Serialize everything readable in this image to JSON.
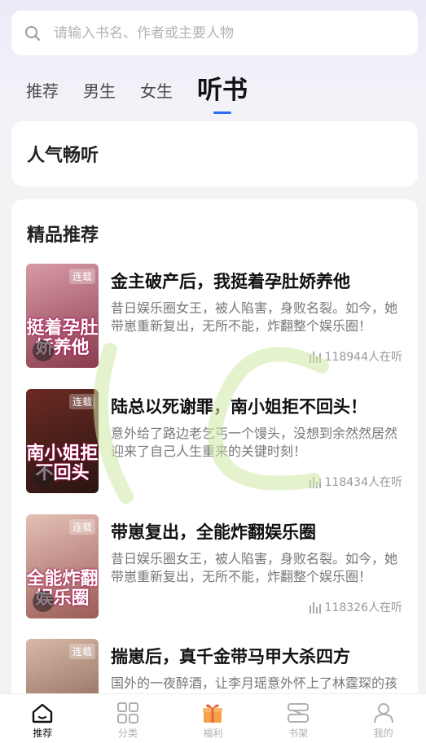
{
  "search": {
    "placeholder": "请输入书名、作者或主要人物"
  },
  "tabs": [
    {
      "label": "推荐",
      "active": false
    },
    {
      "label": "男生",
      "active": false
    },
    {
      "label": "女生",
      "active": false
    },
    {
      "label": "听书",
      "active": true
    }
  ],
  "sections": {
    "popular_title": "人气畅听",
    "featured_title": "精品推荐"
  },
  "books": [
    {
      "title": "金主破产后，我挺着孕肚娇养他",
      "desc": "昔日娱乐圈女王，被人陷害，身败名裂。如今，她带崽重新复出，无所不能，炸翻整个娱乐圈！",
      "listeners": "118944人在听",
      "badge": "连载",
      "cover_text": "挺着孕肚娇养他",
      "cover_colors": [
        "#d79aa6",
        "#8a3b4d"
      ]
    },
    {
      "title": "陆总以死谢罪，南小姐拒不回头！",
      "desc": "意外给了路边老乞丐一个馒头，没想到余然然居然迎来了自己人生重来的关键时刻！",
      "listeners": "118434人在听",
      "badge": "连载",
      "cover_text": "南小姐拒不回头",
      "cover_colors": [
        "#6a2a22",
        "#2b1512"
      ]
    },
    {
      "title": "带崽复出，全能炸翻娱乐圈",
      "desc": "昔日娱乐圈女王，被人陷害，身败名裂。如今，她带崽重新复出，无所不能，炸翻整个娱乐圈！",
      "listeners": "118326人在听",
      "badge": "连载",
      "cover_text": "全能炸翻娱乐圈",
      "cover_colors": [
        "#e4c0b6",
        "#9b5c57"
      ]
    },
    {
      "title": "揣崽后，真千金带马甲大杀四方",
      "desc": "国外的一夜醉酒，让李月瑶意外怀上了林霆琛的孩子。",
      "listeners": "",
      "badge": "连载",
      "cover_text": "",
      "cover_colors": [
        "#d8b9a8",
        "#7c5446"
      ]
    }
  ],
  "nav": [
    {
      "label": "推荐",
      "icon": "home-icon",
      "active": true
    },
    {
      "label": "分类",
      "icon": "grid-icon",
      "active": false
    },
    {
      "label": "福利",
      "icon": "gift-icon",
      "active": false
    },
    {
      "label": "书架",
      "icon": "bookshelf-icon",
      "active": false
    },
    {
      "label": "我的",
      "icon": "user-icon",
      "active": false
    }
  ],
  "colors": {
    "accent": "#2f6cf5",
    "gift": "#f5a04a"
  }
}
